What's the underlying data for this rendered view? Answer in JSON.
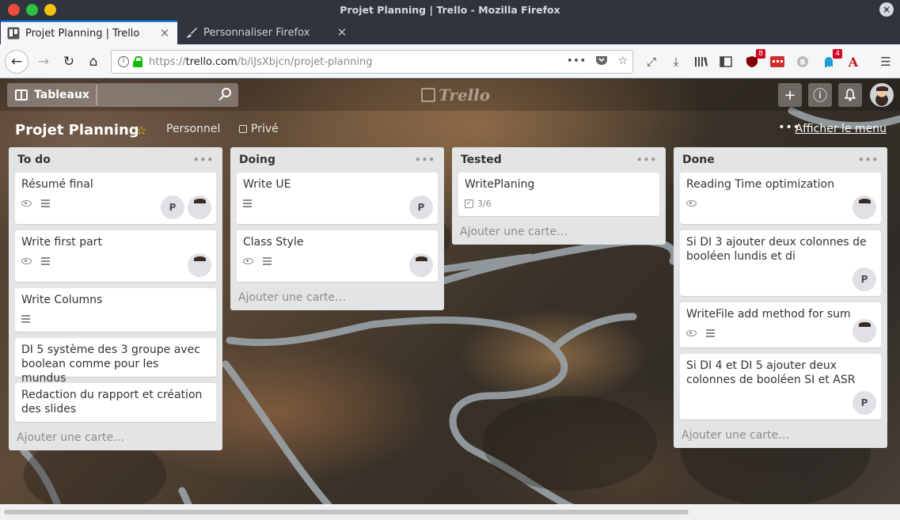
{
  "window": {
    "title": "Projet Planning | Trello - Mozilla Firefox"
  },
  "tabs": [
    {
      "label": "Projet Planning | Trello",
      "icon": "trello-favicon-icon"
    },
    {
      "label": "Personnaliser Firefox",
      "icon": "brush-icon"
    }
  ],
  "address": {
    "url_prefix": "https://",
    "url_host": "trello.com",
    "url_path": "/b/iJsXbjcn/projet-planning"
  },
  "toolbar_badges": {
    "ublock": "8",
    "ghostery": "4"
  },
  "board_header": {
    "boards_label": "Tableaux",
    "logo_text": "Trello"
  },
  "board": {
    "title": "Projet Planning",
    "team": "Personnel",
    "visibility": "Privé",
    "menu_label": "Afficher le menu"
  },
  "add_card_label": "Ajouter une carte…",
  "lists": [
    {
      "name": "To do",
      "cards": [
        {
          "title": "Résumé final"
        },
        {
          "title": "Write first part"
        },
        {
          "title": "Write Columns"
        },
        {
          "title": "DI 5 système des 3 groupe avec boolean comme pour les mundus"
        },
        {
          "title": "Redaction du rapport et création des slides"
        }
      ]
    },
    {
      "name": "Doing",
      "cards": [
        {
          "title": "Write UE"
        },
        {
          "title": "Class Style"
        }
      ]
    },
    {
      "name": "Tested",
      "cards": [
        {
          "title": "WritePlaning",
          "checklist": "3/6"
        }
      ]
    },
    {
      "name": "Done",
      "cards": [
        {
          "title": "Reading Time optimization"
        },
        {
          "title": "Si DI 3 ajouter deux colonnes de booléen lundis et di"
        },
        {
          "title": "WriteFile add method for sum"
        },
        {
          "title": "Si DI 4 et DI 5 ajouter deux colonnes de booléen SI et ASR"
        }
      ]
    }
  ],
  "member_initial": "P"
}
